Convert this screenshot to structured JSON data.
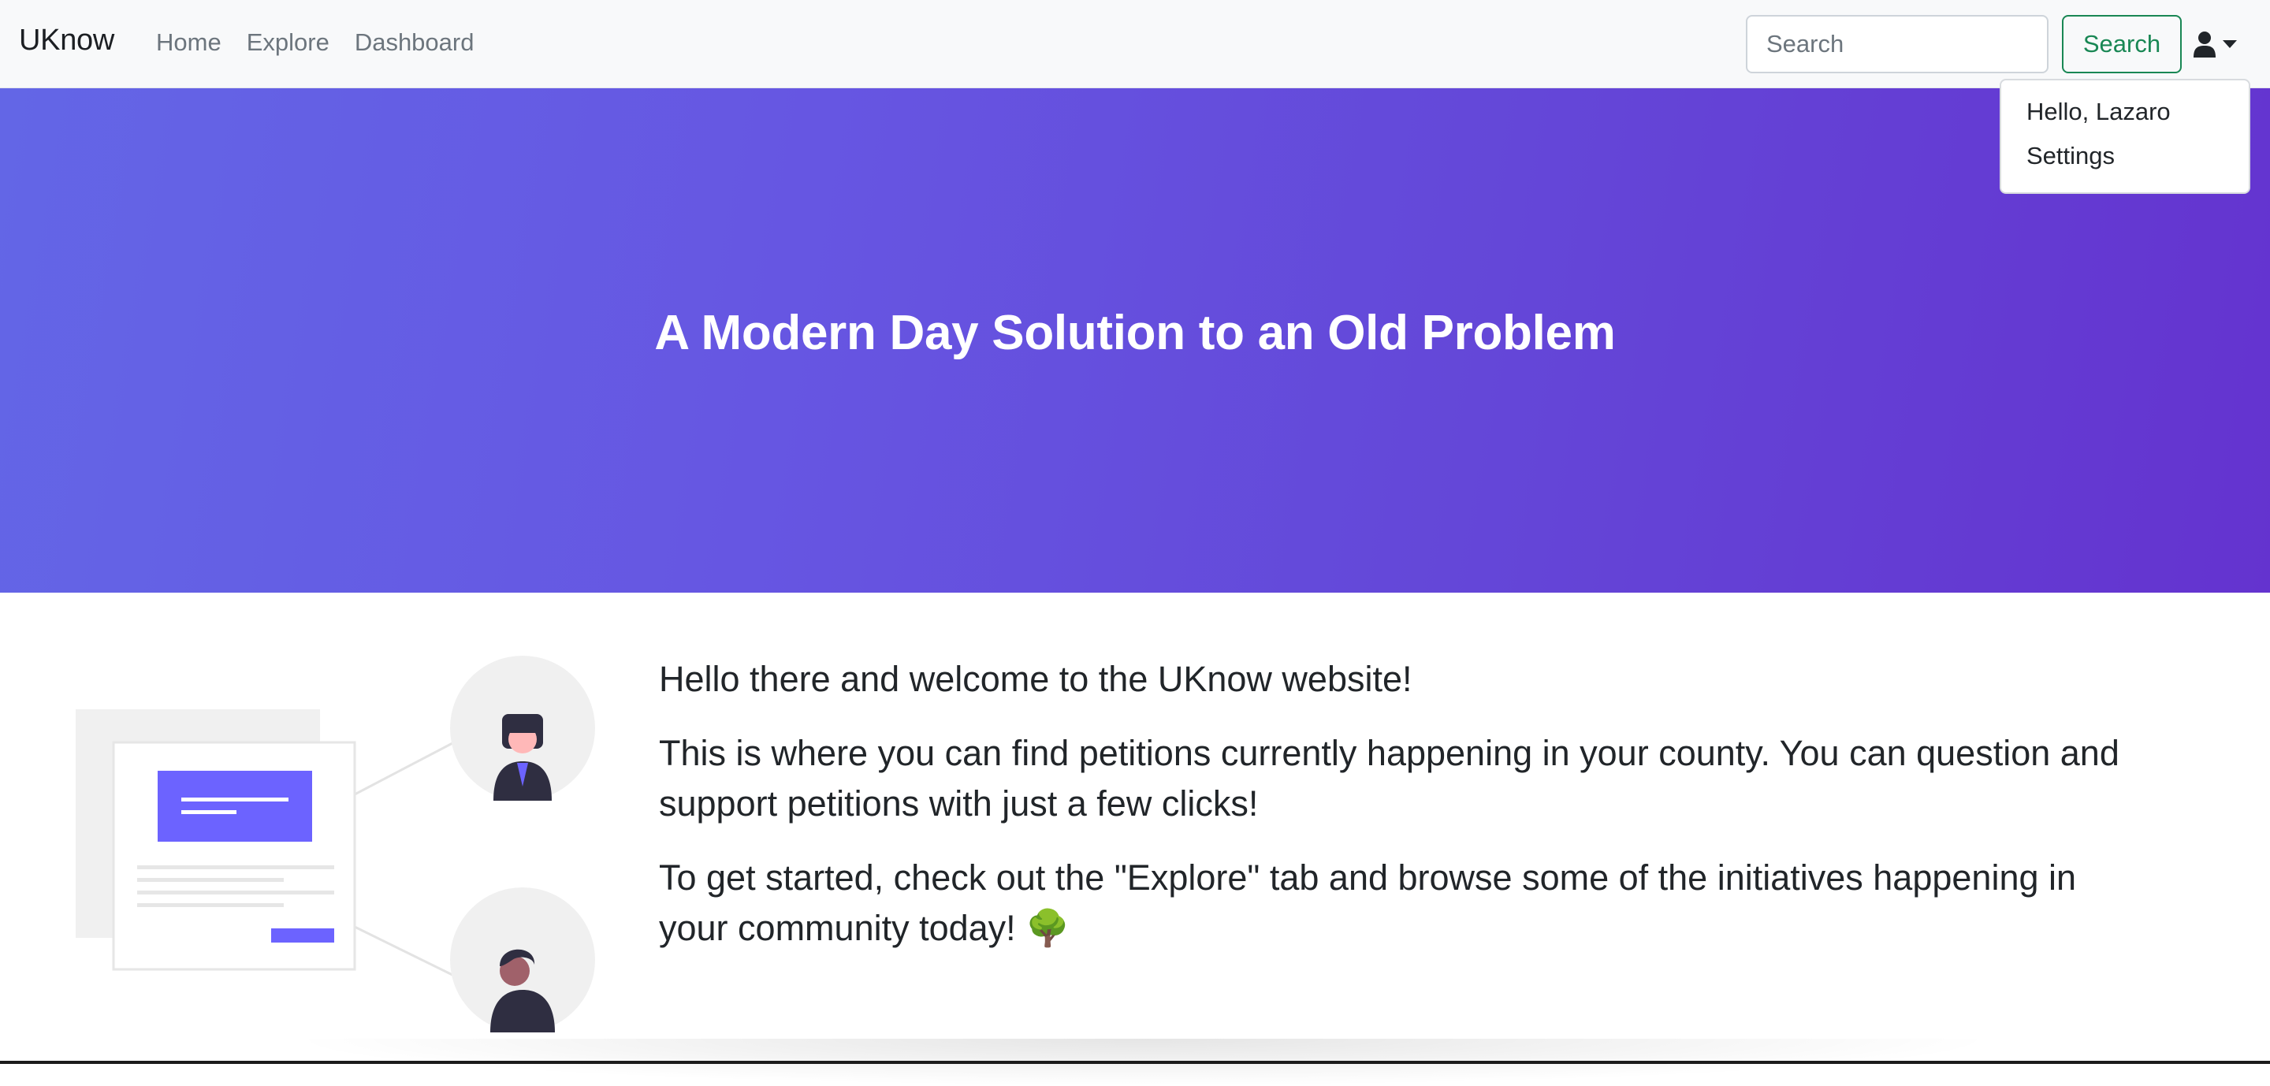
{
  "navbar": {
    "brand": "UKnow",
    "links": [
      {
        "label": "Home"
      },
      {
        "label": "Explore"
      },
      {
        "label": "Dashboard"
      }
    ],
    "search": {
      "placeholder": "Search",
      "value": ""
    },
    "search_button_label": "Search",
    "user_icon": "user-icon"
  },
  "user_menu": {
    "greeting": "Hello, Lazaro",
    "settings": "Settings"
  },
  "hero": {
    "title": "A Modern Day Solution to an Old Problem",
    "colors": {
      "start": "#6366e6",
      "end": "#6433cf"
    }
  },
  "content": {
    "paragraphs": [
      "Hello there and welcome to the UKnow website!",
      "This is where you can find petitions currently happening in your county. You can question and support petitions with just a few clicks!",
      "To get started, check out the \"Explore\" tab and browse some of the initiatives happening in your community today! 🌳"
    ]
  },
  "colors": {
    "accent": "#6c63ff",
    "success": "#198754",
    "navbar_bg": "#f8f9fa"
  }
}
